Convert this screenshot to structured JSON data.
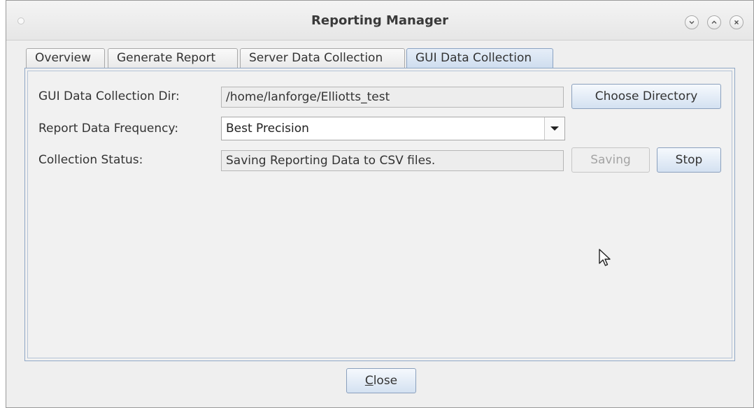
{
  "window": {
    "title": "Reporting Manager"
  },
  "tabs": [
    {
      "label": "Overview",
      "active": false
    },
    {
      "label": "Generate Report",
      "active": false
    },
    {
      "label": "Server Data Collection",
      "active": false
    },
    {
      "label": "GUI Data Collection",
      "active": true
    }
  ],
  "form": {
    "dir_label": "GUI Data Collection Dir:",
    "dir_value": "/home/lanforge/Elliotts_test",
    "choose_dir_button": "Choose Directory",
    "freq_label": "Report Data Frequency:",
    "freq_value": "Best Precision",
    "status_label": "Collection Status:",
    "status_value": "Saving Reporting Data to CSV files.",
    "saving_button": "Saving",
    "stop_button": "Stop"
  },
  "footer": {
    "close_mnemonic": "C",
    "close_rest": "lose"
  },
  "colors": {
    "active_tab": "#cddcee",
    "button_gradient_bottom": "#d4e1f1",
    "panel_border": "#8fa7c6"
  },
  "icons": [
    "minimize-icon",
    "maximize-icon",
    "close-icon",
    "dropdown-arrow-icon",
    "mouse-cursor-icon"
  ]
}
